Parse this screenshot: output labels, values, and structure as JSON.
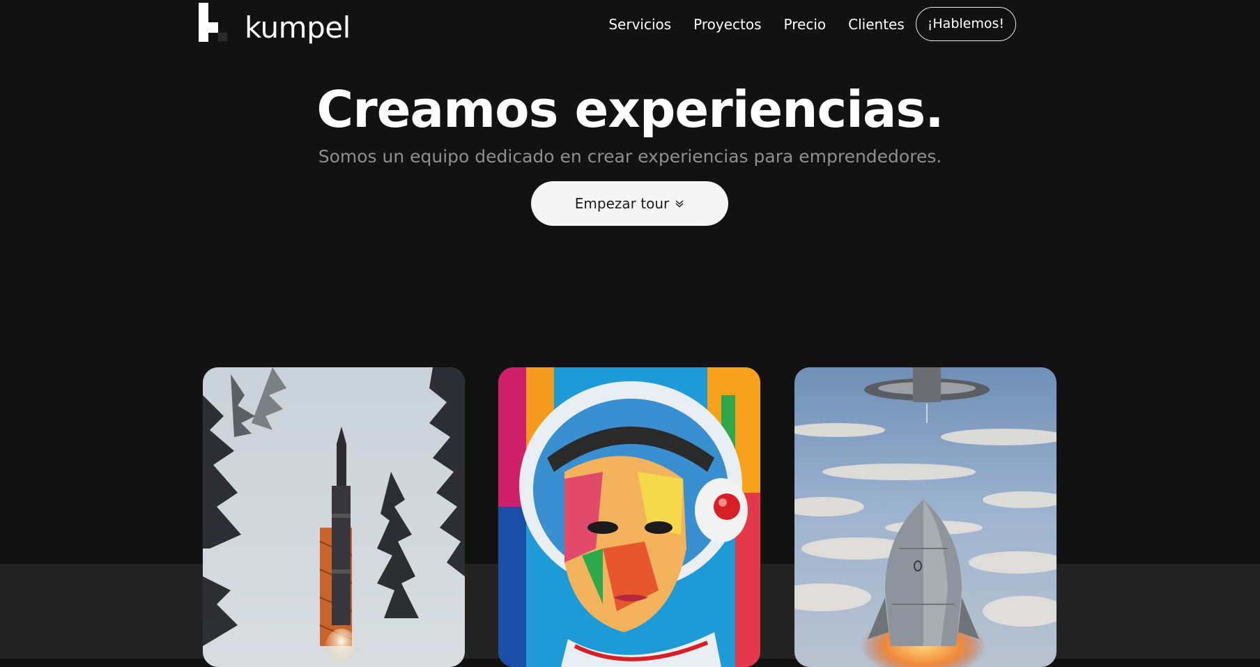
{
  "header": {
    "brand": "kumpel",
    "nav": [
      "Servicios",
      "Proyectos",
      "Precio",
      "Clientes"
    ],
    "cta": "¡Hablemos!"
  },
  "hero": {
    "title": "Creamos experiencias.",
    "subtitle": "Somos un equipo dedicado en crear experiencias para emprendedores.",
    "button": "Empezar tour",
    "button_icon": "double-chevron-down-icon"
  },
  "gallery": {
    "cards": [
      {
        "image": "rocket-launch-forest-image"
      },
      {
        "image": "astronaut-painting-image"
      },
      {
        "image": "spaceship-clouds-image"
      }
    ]
  },
  "colors": {
    "background": "#121212",
    "lower_band": "#232323",
    "text": "#ffffff",
    "muted_text": "#8f8f8f",
    "button_bg": "#f5f5f5"
  }
}
